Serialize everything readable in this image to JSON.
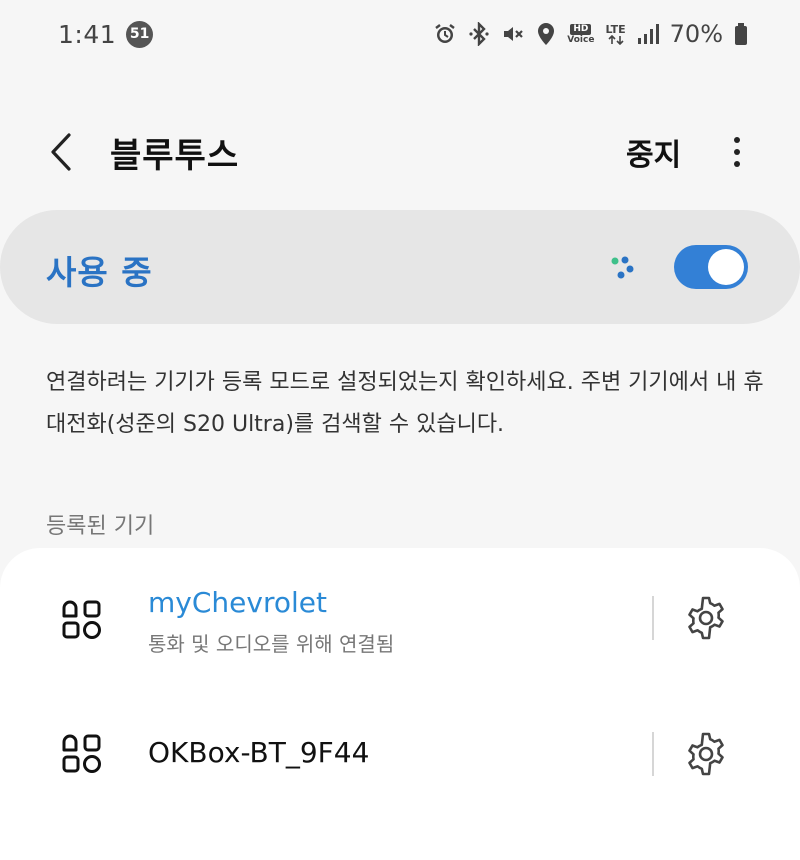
{
  "status_bar": {
    "time": "1:41",
    "notification_count": "51",
    "hd": "HD",
    "voice": "Voice",
    "lte": "LTE",
    "battery": "70%"
  },
  "header": {
    "title": "블루투스",
    "stop_label": "중지"
  },
  "master_switch": {
    "label": "사용 중",
    "enabled": true,
    "accent": "#3380d6"
  },
  "description": "연결하려는 기기가 등록 모드로 설정되었는지 확인하세요. 주변 기기에서 내 휴대전화(성준의 S20 Ultra)를 검색할 수 있습니다.",
  "paired_section": {
    "label": "등록된 기기",
    "devices": [
      {
        "name": "myChevrolet",
        "status": "통화 및 오디오를 위해 연결됨",
        "connected": true,
        "icon": "apps-grid-icon"
      },
      {
        "name": "OKBox-BT_9F44",
        "status": "",
        "connected": false,
        "icon": "apps-grid-icon"
      }
    ]
  }
}
